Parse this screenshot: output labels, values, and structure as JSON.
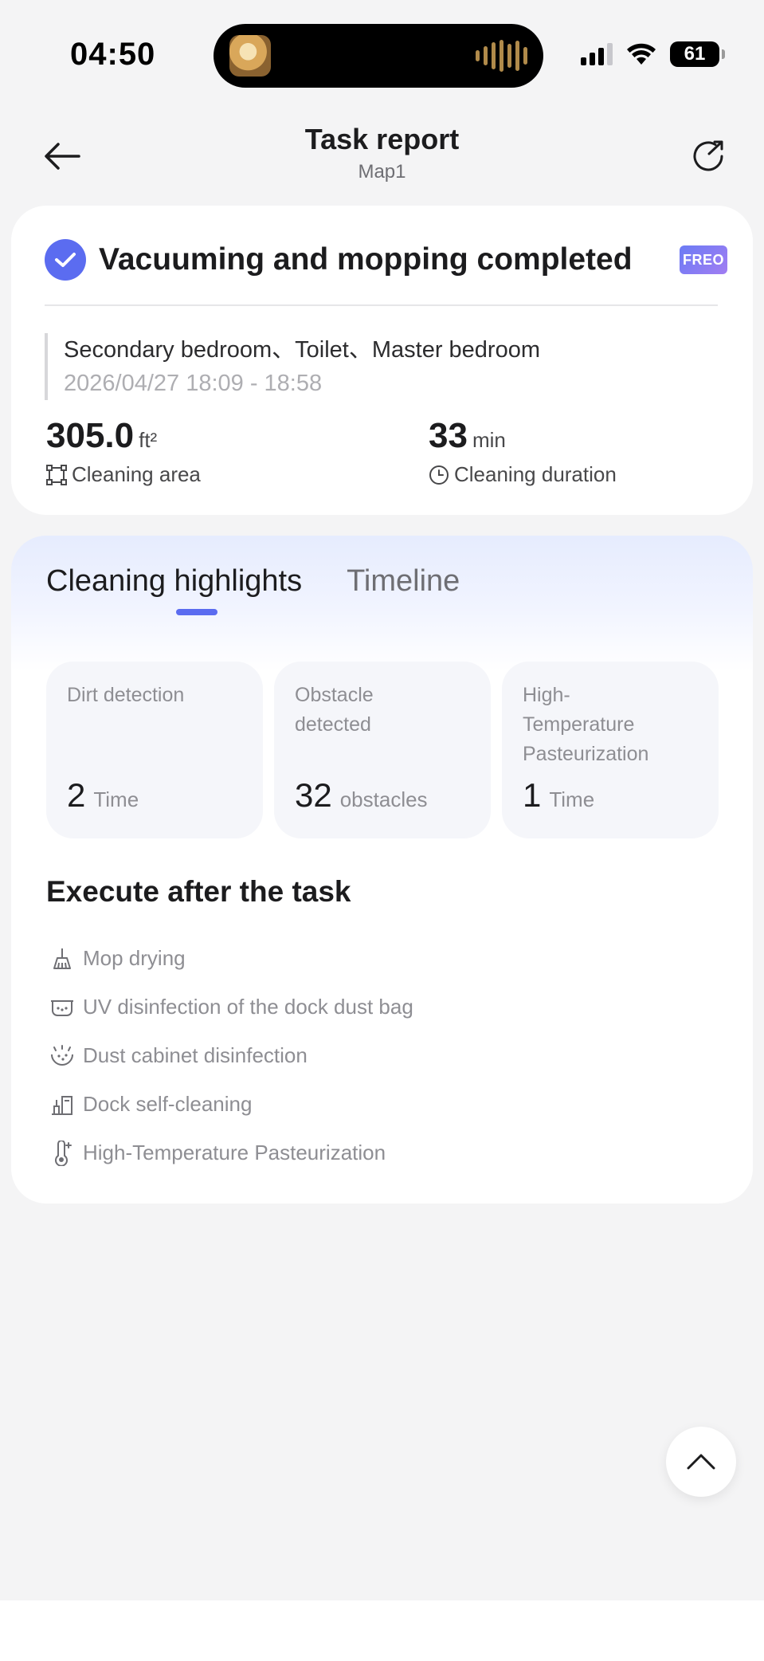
{
  "status_bar": {
    "time": "04:50",
    "battery": "61"
  },
  "header": {
    "title": "Task report",
    "subtitle": "Map1"
  },
  "summary": {
    "status": "Vacuuming and mopping completed",
    "badge": "FREO",
    "rooms": "Secondary bedroom、Toilet、Master bedroom",
    "time_range": "2026/04/27 18:09 - 18:58",
    "area_value": "305.0",
    "area_unit": "ft²",
    "area_label": "Cleaning area",
    "duration_value": "33",
    "duration_unit": "min",
    "duration_label": "Cleaning duration"
  },
  "tabs": [
    {
      "label": "Cleaning highlights",
      "active": true
    },
    {
      "label": "Timeline",
      "active": false
    }
  ],
  "metrics": [
    {
      "label": "Dirt detection",
      "value": "2",
      "unit": "Time"
    },
    {
      "label": "Obstacle detected",
      "value": "32",
      "unit": "obstacles"
    },
    {
      "label": "High-Temperature Pasteurization",
      "value": "1",
      "unit": "Time"
    }
  ],
  "execute": {
    "title": "Execute after the task",
    "items": [
      {
        "label": "Mop drying",
        "icon": "mop-icon"
      },
      {
        "label": "UV disinfection of the dock dust bag",
        "icon": "dust-bag-icon"
      },
      {
        "label": "Dust cabinet disinfection",
        "icon": "cabinet-disinfect-icon"
      },
      {
        "label": "Dock self-cleaning",
        "icon": "dock-clean-icon"
      },
      {
        "label": "High-Temperature Pasteurization",
        "icon": "thermometer-icon"
      }
    ]
  },
  "colors": {
    "accent": "#5b6cf0",
    "background": "#f4f4f5",
    "muted_text": "#8e8e93"
  }
}
